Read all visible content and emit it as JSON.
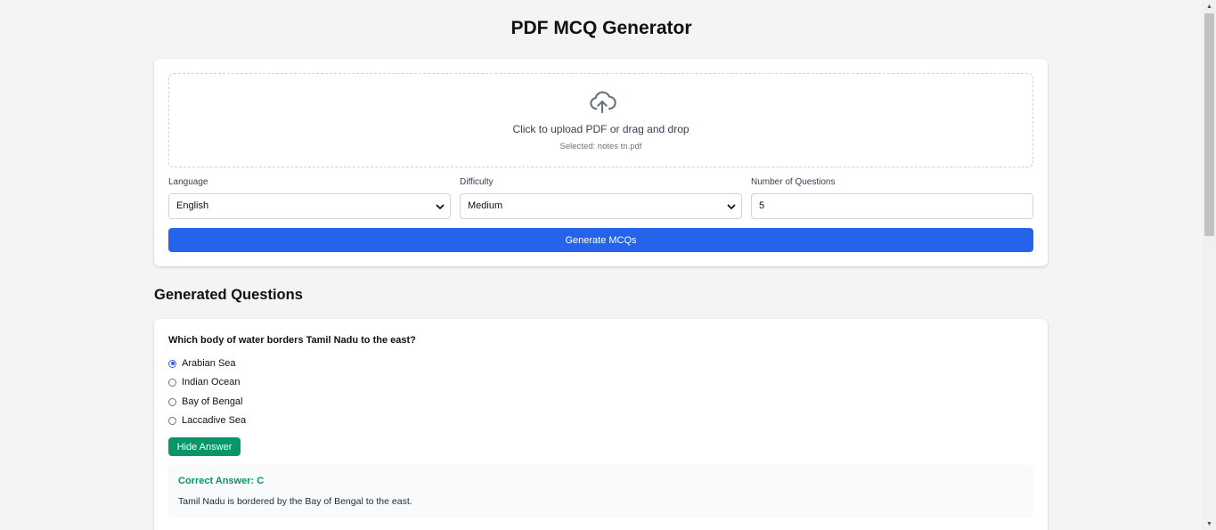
{
  "header": {
    "title": "PDF MCQ Generator"
  },
  "upload": {
    "icon": "cloud-upload-icon",
    "prompt": "Click to upload PDF or drag and drop",
    "selected": "Selected: notes tn.pdf"
  },
  "form": {
    "language": {
      "label": "Language",
      "value": "English"
    },
    "difficulty": {
      "label": "Difficulty",
      "value": "Medium"
    },
    "num_questions": {
      "label": "Number of Questions",
      "value": "5"
    },
    "generate_label": "Generate MCQs"
  },
  "results": {
    "title": "Generated Questions",
    "questions": [
      {
        "text": "Which body of water borders Tamil Nadu to the east?",
        "options": [
          "Arabian Sea",
          "Indian Ocean",
          "Bay of Bengal",
          "Laccadive Sea"
        ],
        "selected": "Arabian Sea",
        "toggle_label": "Hide Answer",
        "correct": "Correct Answer: C",
        "explanation": "Tamil Nadu is bordered by the Bay of Bengal to the east."
      }
    ]
  },
  "colors": {
    "primary": "#2563eb",
    "success": "#059669",
    "background": "#f3f4f6"
  }
}
